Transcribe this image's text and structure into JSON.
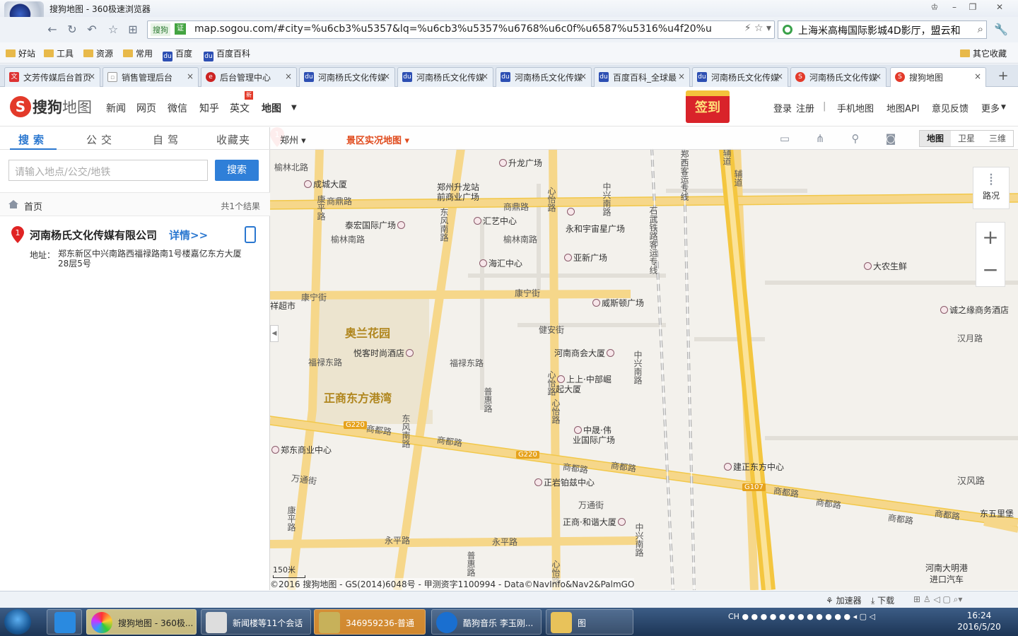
{
  "browser": {
    "title": "搜狗地图 - 360极速浏览器",
    "url": "map.sogou.com/#city=%u6cb3%u5357&lq=%u6cb3%u5357%u6768%u6c0f%u6587%u5316%u4f20%u",
    "addr_tag": "搜狗",
    "addr_badge": "证",
    "search_text": "上海米高梅国际影城4D影厅，盟云和"
  },
  "bookmarks": [
    {
      "label": "好站"
    },
    {
      "label": "工具"
    },
    {
      "label": "资源"
    },
    {
      "label": "常用"
    },
    {
      "label": "百度"
    },
    {
      "label": "百度百科"
    }
  ],
  "bookmarks_right": "其它收藏",
  "tabs": [
    {
      "label": "文芳传媒后台首页"
    },
    {
      "label": "销售管理后台"
    },
    {
      "label": "后台管理中心"
    },
    {
      "label": "河南杨氏文化传媒"
    },
    {
      "label": "河南杨氏文化传媒"
    },
    {
      "label": "河南杨氏文化传媒"
    },
    {
      "label": "百度百科_全球最"
    },
    {
      "label": "河南杨氏文化传媒"
    },
    {
      "label": "河南杨氏文化传媒"
    },
    {
      "label": "搜狗地图"
    }
  ],
  "sogou": {
    "logo_s": "S",
    "logo_text1": "搜狗",
    "logo_text2": "地图",
    "nav": [
      "新闻",
      "网页",
      "微信",
      "知乎",
      "英文",
      "地图"
    ],
    "new_badge": "新",
    "sign": "签到",
    "right_links": [
      "登录",
      "注册",
      "|",
      "手机地图",
      "地图API",
      "意见反馈",
      "更多"
    ]
  },
  "left": {
    "tabs": [
      "搜索",
      "公交",
      "自驾",
      "收藏夹"
    ],
    "search_placeholder": "请输入地点/公交/地铁",
    "search_button": "搜索",
    "crumb": "首页",
    "result_count": "共1个结果",
    "result": {
      "index": "1",
      "name": "河南杨氏文化传媒有限公司",
      "detail": "详情>>",
      "addr_label": "地址：",
      "addr": "郑东新区中兴南路西福禄路南1号楼嘉亿东方大厦28层5号"
    }
  },
  "map": {
    "city": "郑州",
    "scenic": "景区实况地图",
    "types": [
      "地图",
      "卫星",
      "三维"
    ],
    "traffic": "路况",
    "zoom_in": "+",
    "zoom_out": "−",
    "scale": "150米",
    "copyright": "©2016 搜狗地图 - GS(2014)6048号 - 甲测资字1100994 - Data©NavInfo&Nav2&PalmGO",
    "pin": "1",
    "areas": [
      "奥兰花园",
      "正商东方港湾"
    ],
    "roads": [
      "榆林北路",
      "商鼎路",
      "商鼎路",
      "康平路",
      "东风南路",
      "心怡路",
      "榆林南路",
      "榆林南路",
      "康宁街",
      "康宁街",
      "健安街",
      "福禄东路",
      "福禄东路",
      "普惠路",
      "心怡路",
      "心怡路",
      "商都路",
      "商都路",
      "商都路",
      "商都路",
      "商都路",
      "商都路",
      "商都路",
      "万通街",
      "万通街",
      "康平路",
      "永平路",
      "永平路",
      "普惠路",
      "心怡路",
      "中兴南路",
      "中兴南路",
      "中兴南路",
      "石武铁路客运专线",
      "郑西客运专线",
      "汉月路",
      "汉风路",
      "辅道",
      "辅道",
      "东风南路",
      "商都路"
    ],
    "shields": [
      "G220",
      "G220",
      "G107"
    ],
    "pois": [
      "升龙广场",
      "成城大厦",
      "郑州升龙站前商业广场",
      "泰宏国际广场",
      "汇艺中心",
      "永和宇宙星广场",
      "海汇中心",
      "亚新广场",
      "大农生鲜",
      "威斯顿广场",
      "诚之缘商务酒店",
      "悦客时尚酒店",
      "河南商会大厦",
      "上上·中部崛起大厦",
      "中晟·伟业国际广场",
      "郑东商业中心",
      "建正东方中心",
      "正岩铂兹中心",
      "正商·和谐大厦",
      "河南大明港进口汽车",
      "东五里堡",
      "祥超市"
    ]
  },
  "statusbar": {
    "accelerator": "加速器",
    "download": "下载"
  },
  "taskbar": {
    "apps": [
      "搜狗地图 - 360极...",
      "新闻楼等11个会话",
      "346959236-普通",
      "酷狗音乐 李玉刚...",
      "图"
    ],
    "time": "16:24",
    "date": "2016/5/20",
    "lang": "CH"
  }
}
